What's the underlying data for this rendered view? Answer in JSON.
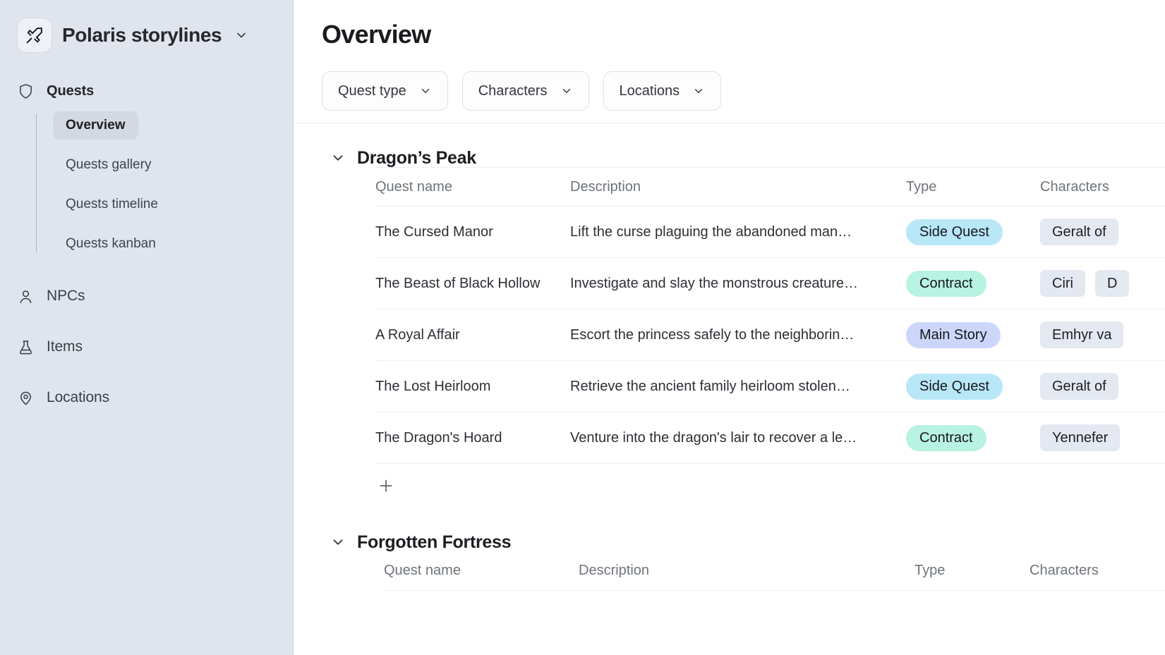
{
  "workspace": {
    "title": "Polaris storylines",
    "logo_icon": "sword-icon",
    "caret_icon": "chevron-down-icon"
  },
  "sidebar": {
    "background_color": "#dfe4ed",
    "group": {
      "label": "Quests",
      "icon": "shield-icon",
      "items": [
        {
          "label": "Overview",
          "active": true
        },
        {
          "label": "Quests gallery",
          "active": false
        },
        {
          "label": "Quests timeline",
          "active": false
        },
        {
          "label": "Quests kanban",
          "active": false
        }
      ]
    },
    "items": [
      {
        "label": "NPCs",
        "icon": "user-icon"
      },
      {
        "label": "Items",
        "icon": "flask-icon"
      },
      {
        "label": "Locations",
        "icon": "map-pin-icon"
      }
    ]
  },
  "main": {
    "page_title": "Overview",
    "filters": [
      {
        "label": "Quest type",
        "icon": "chevron-down-icon"
      },
      {
        "label": "Characters",
        "icon": "chevron-down-icon"
      },
      {
        "label": "Locations",
        "icon": "chevron-down-icon"
      }
    ],
    "add_row_icon": "plus-icon",
    "columns": [
      "Quest name",
      "Description",
      "Type",
      "Characters"
    ],
    "type_colors": {
      "Side Quest": "#b8e7f8",
      "Contract": "#b8f2e2",
      "Main Story": "#ccd6fb"
    },
    "groups": [
      {
        "title": "Dragon’s Peak",
        "caret_icon": "chevron-down-icon",
        "expanded": true,
        "rows": [
          {
            "name": "The Cursed Manor",
            "description": "Lift the curse plaguing the abandoned man…",
            "type": "Side Quest",
            "characters": [
              "Geralt of"
            ]
          },
          {
            "name": "The Beast of Black Hollow",
            "description": "Investigate and slay the monstrous creature…",
            "type": "Contract",
            "characters": [
              "Ciri",
              "D"
            ]
          },
          {
            "name": "A Royal Affair",
            "description": "Escort the princess safely to the neighborin…",
            "type": "Main Story",
            "characters": [
              "Emhyr va"
            ]
          },
          {
            "name": "The Lost Heirloom",
            "description": "Retrieve the ancient family heirloom stolen…",
            "type": "Side Quest",
            "characters": [
              "Geralt of"
            ]
          },
          {
            "name": "The Dragon's Hoard",
            "description": "Venture into the dragon's lair to recover a le…",
            "type": "Contract",
            "characters": [
              "Yennefer"
            ]
          }
        ]
      },
      {
        "title": "Forgotten Fortress",
        "caret_icon": "chevron-down-icon",
        "expanded": true,
        "rows": []
      }
    ]
  }
}
